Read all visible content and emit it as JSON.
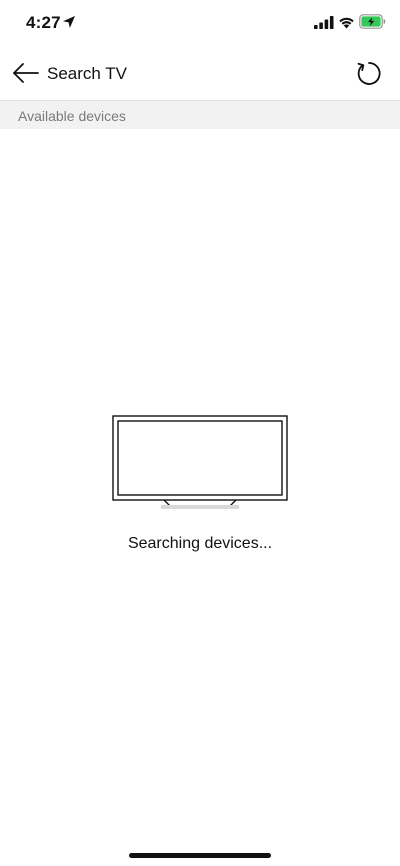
{
  "status_bar": {
    "time": "4:27",
    "icons": [
      "location-arrow-icon",
      "cellular-signal-icon",
      "wifi-icon",
      "battery-charging-icon"
    ],
    "battery_color": "#34c759"
  },
  "header": {
    "back_icon": "arrow-left-icon",
    "title": "Search TV",
    "refresh_icon": "refresh-icon"
  },
  "section": {
    "label": "Available devices"
  },
  "empty_state": {
    "illustration": "tv-icon",
    "message": "Searching devices..."
  }
}
